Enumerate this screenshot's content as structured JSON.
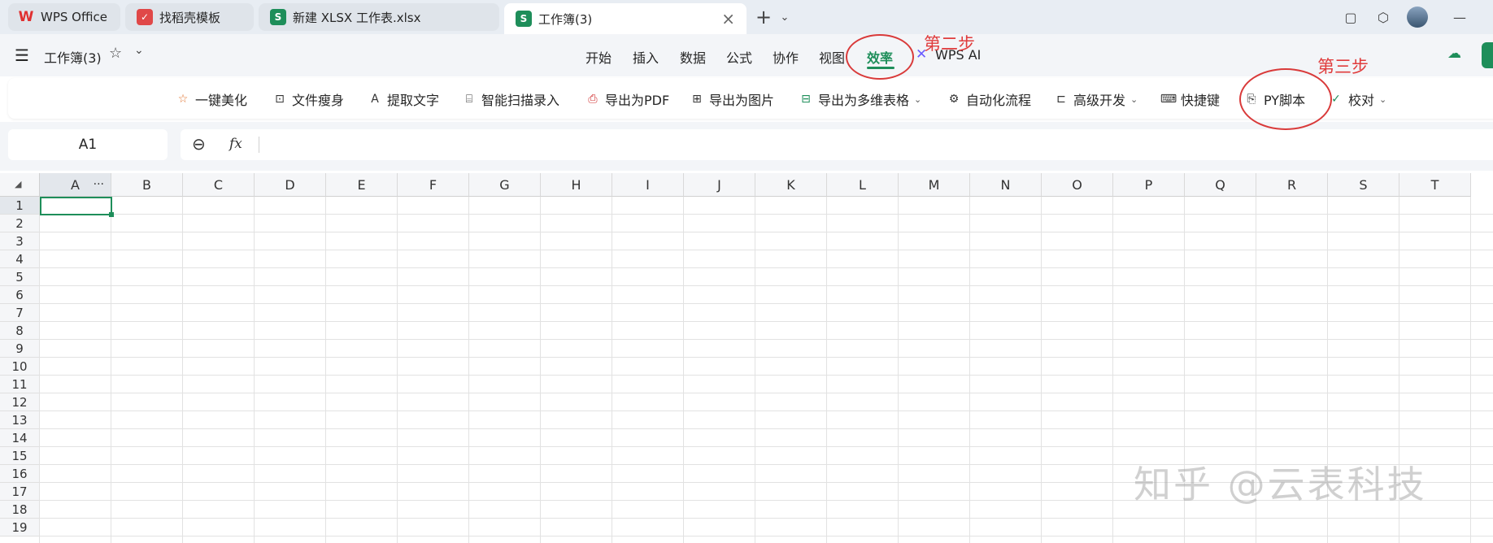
{
  "tabs": [
    {
      "label": "WPS Office",
      "icon": "wps-logo-icon"
    },
    {
      "label": "找稻壳模板",
      "icon": "docer-icon"
    },
    {
      "label": "新建 XLSX 工作表.xlsx",
      "icon": "sheet-icon"
    },
    {
      "label": "工作簿(3)",
      "icon": "sheet-icon",
      "active": true
    }
  ],
  "tab_icons": {
    "wps": "W",
    "docer": "✓",
    "sheet": "S"
  },
  "window": {
    "new_tab": "+",
    "dropdown": "⌄",
    "restore": "▢",
    "cube": "⬡",
    "minimize": "—"
  },
  "doc": {
    "title": "工作簿(3)",
    "star": "☆",
    "dropdown": "⌄"
  },
  "menu": {
    "items": [
      "开始",
      "插入",
      "数据",
      "公式",
      "协作",
      "视图",
      "效率",
      "WPS AI"
    ],
    "active": "效率"
  },
  "ribbon": {
    "items": [
      {
        "label": "一键美化",
        "icon": "sparkle-icon",
        "glyph": "☆"
      },
      {
        "label": "文件瘦身",
        "icon": "file-slim-icon",
        "glyph": "⊡"
      },
      {
        "label": "提取文字",
        "icon": "extract-text-icon",
        "glyph": "A"
      },
      {
        "label": "智能扫描录入",
        "icon": "scan-icon",
        "glyph": "⌸"
      },
      {
        "label": "导出为PDF",
        "icon": "pdf-icon",
        "glyph": "⎙"
      },
      {
        "label": "导出为图片",
        "icon": "image-icon",
        "glyph": "⊞"
      },
      {
        "label": "导出为多维表格",
        "icon": "multi-table-icon",
        "glyph": "⊟",
        "dropdown": true
      },
      {
        "label": "自动化流程",
        "icon": "automation-icon",
        "glyph": "⚙"
      },
      {
        "label": "高级开发",
        "icon": "dev-icon",
        "glyph": "⊏",
        "dropdown": true
      },
      {
        "label": "快捷键",
        "icon": "keyboard-icon",
        "glyph": "⌨"
      },
      {
        "label": "PY脚本",
        "icon": "py-icon",
        "glyph": "⎘"
      },
      {
        "label": "校对",
        "icon": "proofread-icon",
        "glyph": "✓",
        "dropdown": true
      }
    ]
  },
  "formula": {
    "cell_ref": "A1",
    "fx": "fx",
    "zoom_glyph": "⊖"
  },
  "grid": {
    "columns": [
      "A",
      "B",
      "C",
      "D",
      "E",
      "F",
      "G",
      "H",
      "I",
      "J",
      "K",
      "L",
      "M",
      "N",
      "O",
      "P",
      "Q",
      "R",
      "S",
      "T"
    ],
    "rows": [
      "1",
      "2",
      "3",
      "4",
      "5",
      "6",
      "7",
      "8",
      "9",
      "10",
      "11",
      "12",
      "13",
      "14",
      "15",
      "16",
      "17",
      "18",
      "19"
    ],
    "col_a_more": "···"
  },
  "annotations": {
    "step2": "第二步",
    "step3": "第三步"
  },
  "watermark": "知乎 @云表科技",
  "colors": {
    "accent": "#1e8e5a",
    "annotation": "#d93a3a",
    "wps_red": "#e03030"
  }
}
